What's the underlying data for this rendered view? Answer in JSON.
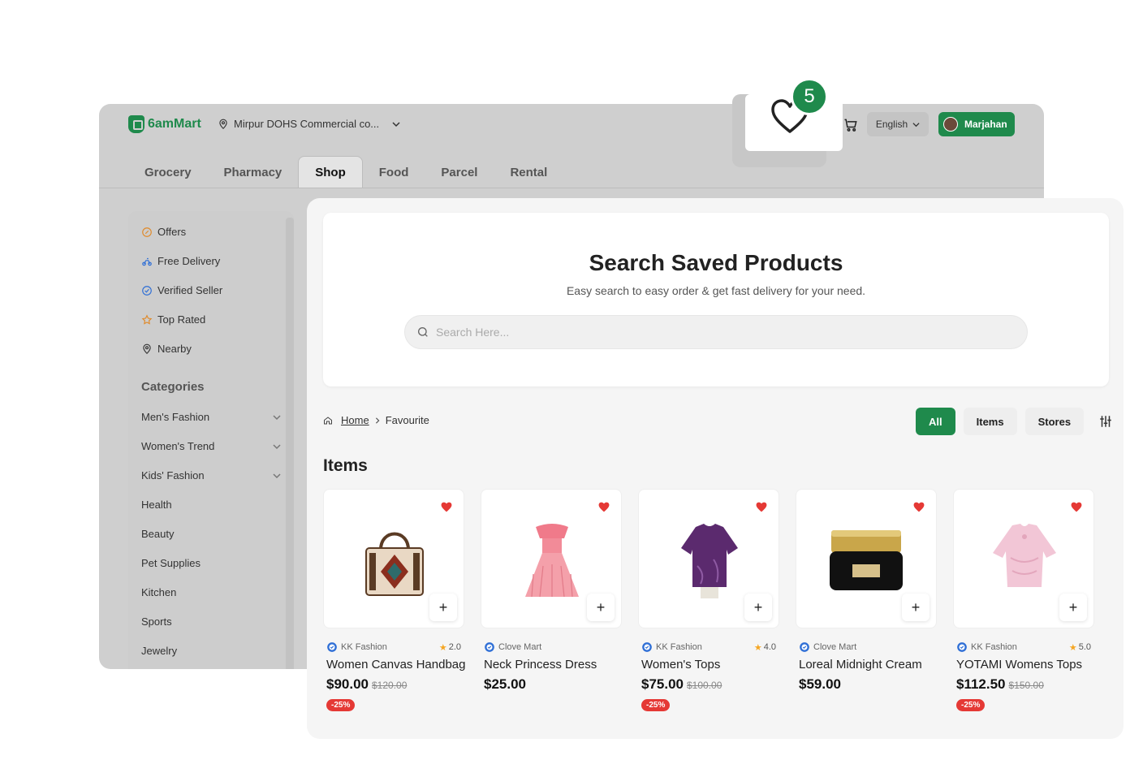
{
  "header": {
    "logo_text": "6amMart",
    "location": "Mirpur DOHS Commercial co...",
    "language": "English",
    "user_name": "Marjahan",
    "favourite_count": "5"
  },
  "modules": [
    {
      "label": "Grocery"
    },
    {
      "label": "Pharmacy"
    },
    {
      "label": "Shop"
    },
    {
      "label": "Food"
    },
    {
      "label": "Parcel"
    },
    {
      "label": "Rental"
    }
  ],
  "sidebar": {
    "quick": [
      {
        "label": "Offers",
        "icon": "offer-icon"
      },
      {
        "label": "Free Delivery",
        "icon": "bike-icon"
      },
      {
        "label": "Verified Seller",
        "icon": "verified-icon"
      },
      {
        "label": "Top Rated",
        "icon": "star-icon"
      },
      {
        "label": "Nearby",
        "icon": "location-pin-icon"
      }
    ],
    "categories_title": "Categories",
    "categories": [
      {
        "label": "Men's Fashion"
      },
      {
        "label": "Women's Trend"
      },
      {
        "label": "Kids' Fashion"
      },
      {
        "label": "Health"
      },
      {
        "label": "Beauty"
      },
      {
        "label": "Pet Supplies"
      },
      {
        "label": "Kitchen"
      },
      {
        "label": "Sports"
      },
      {
        "label": "Jewelry"
      }
    ]
  },
  "search": {
    "title": "Search Saved Products",
    "subtitle": "Easy search to easy order & get fast delivery for your need.",
    "placeholder": "Search Here..."
  },
  "breadcrumb": {
    "home": "Home",
    "current": "Favourite"
  },
  "filters": {
    "all": "All",
    "items": "Items",
    "stores": "Stores"
  },
  "items_title": "Items",
  "products": [
    {
      "store": "KK Fashion",
      "rating": "2.0",
      "name": "Women Canvas Handbag",
      "price": "$90.00",
      "old_price": "$120.00",
      "discount": "-25%"
    },
    {
      "store": "Clove Mart",
      "rating": "",
      "name": "Neck Princess Dress",
      "price": "$25.00",
      "old_price": "",
      "discount": ""
    },
    {
      "store": "KK Fashion",
      "rating": "4.0",
      "name": "Women's Tops",
      "price": "$75.00",
      "old_price": "$100.00",
      "discount": "-25%"
    },
    {
      "store": "Clove Mart",
      "rating": "",
      "name": "Loreal Midnight Cream",
      "price": "$59.00",
      "old_price": "",
      "discount": ""
    },
    {
      "store": "KK Fashion",
      "rating": "5.0",
      "name": "YOTAMI Womens Tops",
      "price": "$112.50",
      "old_price": "$150.00",
      "discount": "-25%"
    }
  ],
  "colors": {
    "brand": "#1f8a4c",
    "heart": "#e53935",
    "discount": "#e53935",
    "star": "#f5a623"
  }
}
